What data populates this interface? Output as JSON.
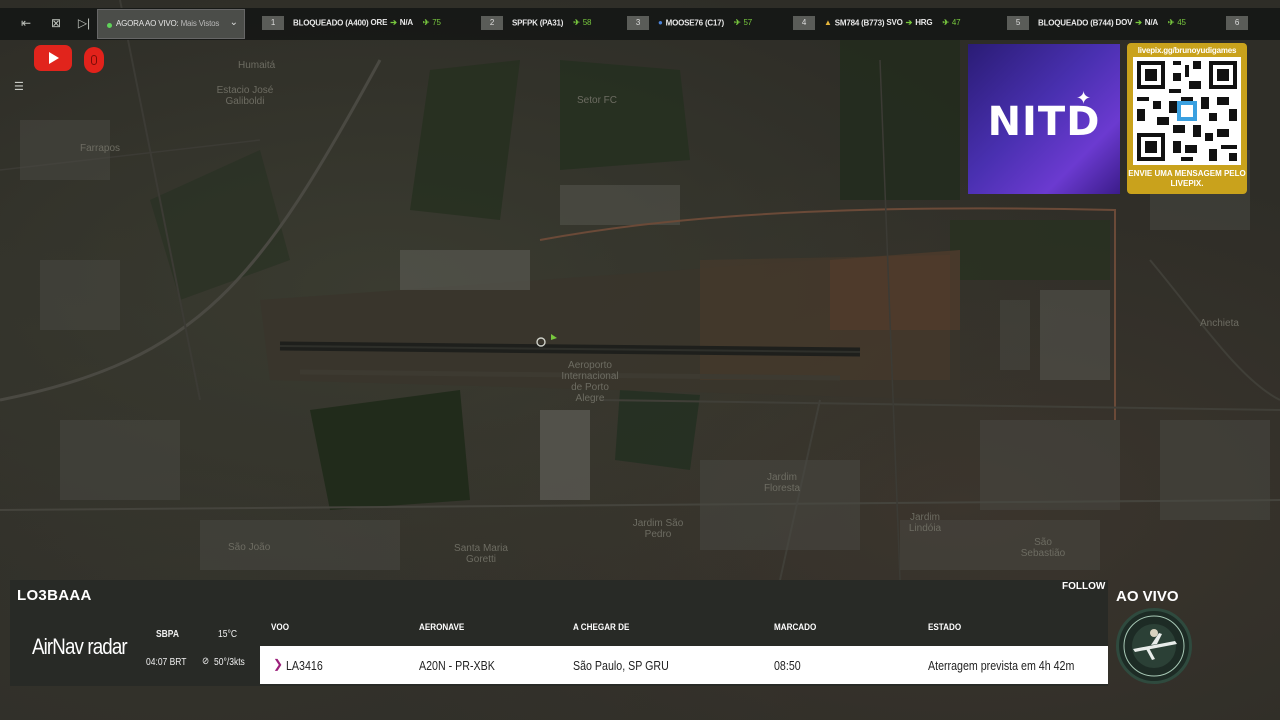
{
  "topbar": {
    "live_label": "AGORA AO VIVO:",
    "live_sub": "Mais Vistos",
    "items": [
      {
        "num": "1",
        "code": "BLOQUEADO (A400)",
        "from": "ORE",
        "to": "N/A",
        "alt": "75",
        "flag": ""
      },
      {
        "num": "2",
        "code": "SPFPK (PA31)",
        "from": "",
        "to": "",
        "alt": "58",
        "flag": ""
      },
      {
        "num": "3",
        "code": "MOOSE76 (C17)",
        "from": "",
        "to": "",
        "alt": "57",
        "flag": "blue"
      },
      {
        "num": "4",
        "code": "SM784 (B773)",
        "from": "SVO",
        "to": "HRG",
        "alt": "47",
        "flag": "warn"
      },
      {
        "num": "5",
        "code": "BLOQUEADO (B744)",
        "from": "DOV",
        "to": "N/A",
        "alt": "45",
        "flag": ""
      },
      {
        "num": "6",
        "code": "",
        "from": "",
        "to": "",
        "alt": "",
        "flag": ""
      }
    ]
  },
  "sponsor": {
    "logo_text": "NITD",
    "qr_url": "livepix.gg/brunoyudigames",
    "qr_message": "ENVIE UMA MENSAGEM PELO LIVEPIX."
  },
  "map_labels": [
    {
      "text": "Humaitá"
    },
    {
      "text": "Farrapos"
    },
    {
      "text": "Estacio José Galiboldi"
    },
    {
      "text": "Setor FC"
    },
    {
      "text": "Aeroporto Internacional de Porto Alegre"
    },
    {
      "text": "Jardim Floresta"
    },
    {
      "text": "Jardim São Pedro"
    },
    {
      "text": "Santa Maria Goretti"
    },
    {
      "text": "Jardim Lindóia"
    },
    {
      "text": "São Sebastião"
    },
    {
      "text": "São João"
    },
    {
      "text": "Anchieta"
    }
  ],
  "flight": {
    "registration": "LO3BAAA",
    "follow_label": "FOLLOW",
    "brand": "AirNav radar",
    "airport": "SBPA",
    "temperature": "15°C",
    "local_time": "04:07 BRT",
    "wind": "50°/3kts",
    "headers": {
      "voo": "VOO",
      "aeronave": "AERONAVE",
      "origem": "A CHEGAR DE",
      "marcado": "MARCADO",
      "estado": "ESTADO"
    },
    "row": {
      "voo": "LA3416",
      "aeronave": "A20N - PR-XBK",
      "origem": "São Paulo, SP GRU",
      "marcado": "08:50",
      "estado": "Aterragem prevista em 4h 42m"
    }
  },
  "stream": {
    "live_label": "AO VIVO"
  },
  "colors": {
    "accent_green": "#78c83e",
    "youtube_red": "#e1241c",
    "qr_gold": "#c9a21c"
  }
}
